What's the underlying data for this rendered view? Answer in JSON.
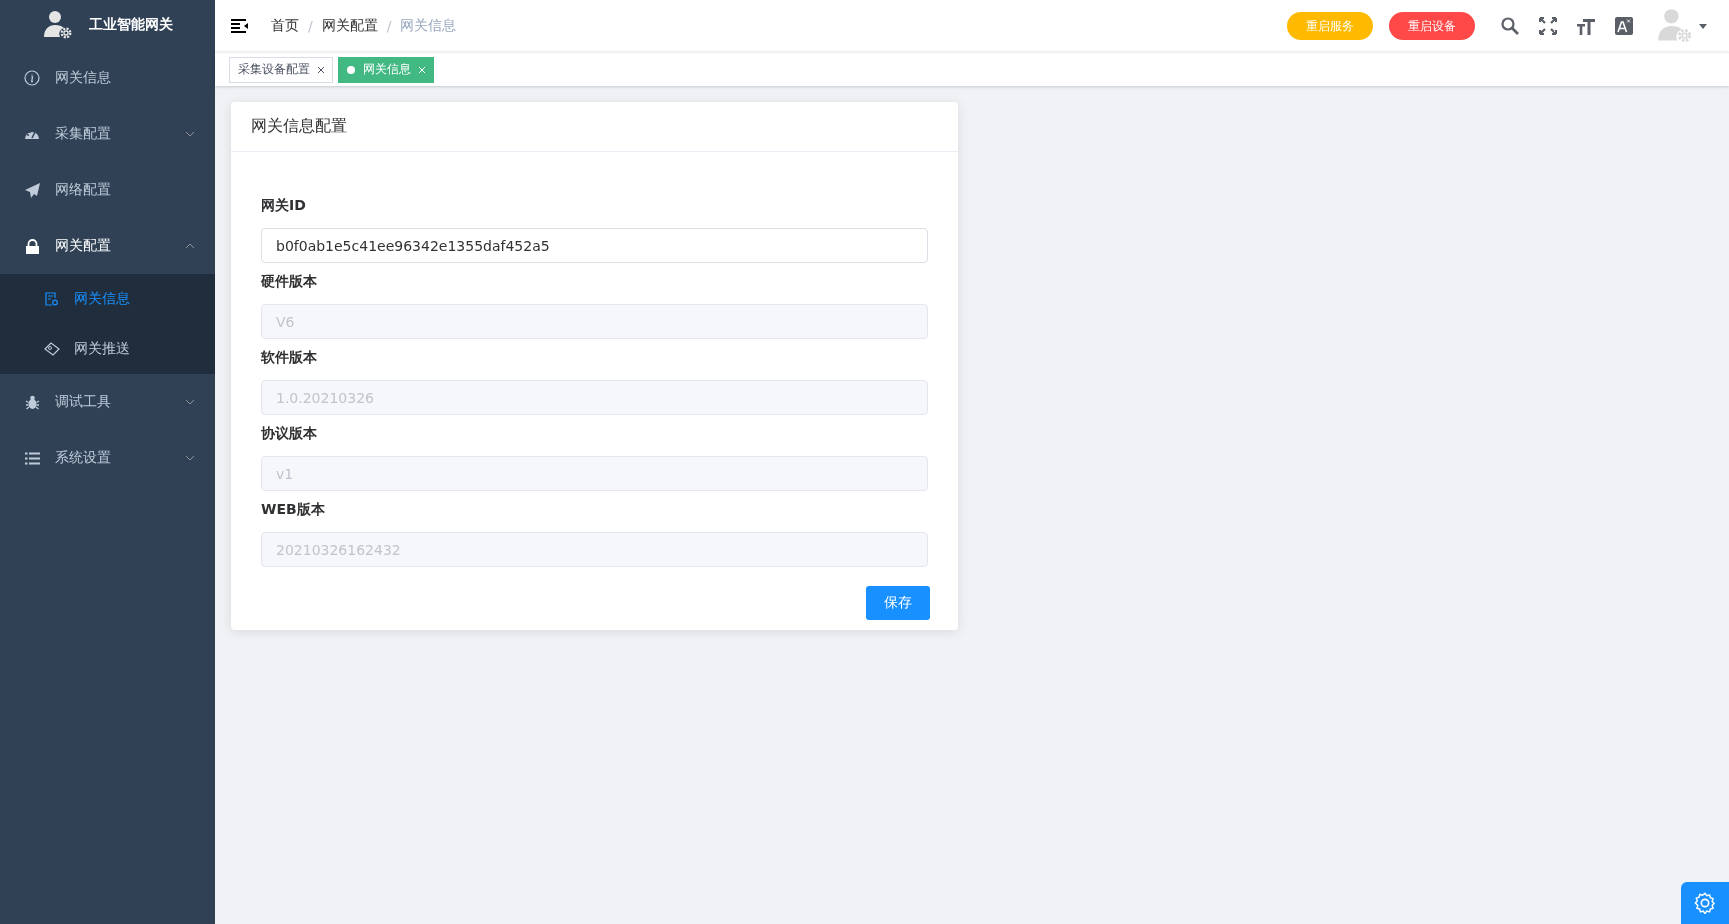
{
  "sidebar": {
    "title": "工业智能网关",
    "menu": [
      {
        "kind": "item",
        "label": "网关信息",
        "selected": false
      },
      {
        "kind": "group",
        "label": "采集配置",
        "expanded": false
      },
      {
        "kind": "item",
        "label": "网络配置",
        "selected": false
      },
      {
        "kind": "group",
        "label": "网关配置",
        "expanded": true,
        "children": [
          {
            "label": "网关信息",
            "selected": true
          },
          {
            "label": "网关推送",
            "selected": false
          }
        ]
      },
      {
        "kind": "group",
        "label": "调试工具",
        "expanded": false
      },
      {
        "kind": "group",
        "label": "系统设置",
        "expanded": false
      }
    ]
  },
  "header": {
    "breadcrumb": [
      "首页",
      "网关配置",
      "网关信息"
    ],
    "separators": [
      "/",
      "/"
    ],
    "buttons": [
      {
        "label": "重启服务",
        "color": "#ffba00"
      },
      {
        "label": "重启设备",
        "color": "#ff4949"
      }
    ]
  },
  "tabs": [
    {
      "label": "采集设备配置",
      "selected": false
    },
    {
      "label": "网关信息",
      "selected": true
    }
  ],
  "card": {
    "title": "网关信息配置",
    "fields": [
      {
        "label": "网关ID",
        "value": "b0f0ab1e5c41ee96342e1355daf452a5",
        "disabled": false
      },
      {
        "label": "硬件版本",
        "value": "V6",
        "disabled": true
      },
      {
        "label": "软件版本",
        "value": "1.0.20210326",
        "disabled": true
      },
      {
        "label": "协议版本",
        "value": "v1",
        "disabled": true
      },
      {
        "label": "WEB版本",
        "value": "20210326162432",
        "disabled": true
      }
    ],
    "save": "保存"
  }
}
